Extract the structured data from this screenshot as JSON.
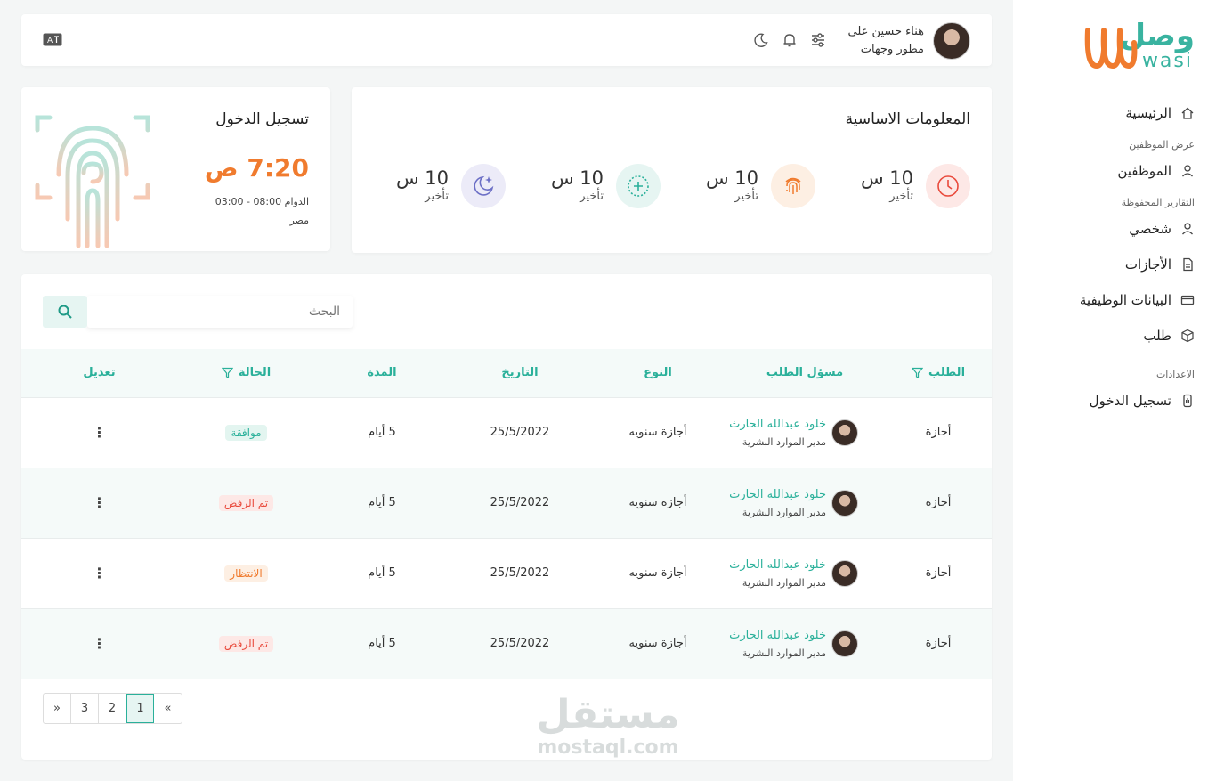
{
  "brand": {
    "name_ar": "وصل",
    "name_en": "wasi",
    "color": "#39b3a0",
    "accent": "#f07b2e"
  },
  "sidebar": {
    "home": "الرئيسية",
    "section_employees": "عرض الموظفين",
    "employees": "الموظفين",
    "section_reports": "التقارير المحفوظة",
    "personal": "شخصي",
    "leaves": "الأجازات",
    "job_data": "البيانات الوظيفية",
    "request": "طلب",
    "section_settings": "الاعدادات",
    "login": "تسجيل الدخول"
  },
  "header": {
    "user_name": "هناء حسين علي",
    "user_role": "مطور وجهات",
    "icons": [
      "sliders-icon",
      "bell-icon",
      "moon-icon",
      "language-icon"
    ]
  },
  "info": {
    "title": "المعلومات الاساسية",
    "stats": [
      {
        "value": "10 س",
        "label": "تأخير",
        "icon": "clock-icon",
        "color": "#e94a3c",
        "bg": "#fde8e6"
      },
      {
        "value": "10 س",
        "label": "تأخير",
        "icon": "fingerprint-icon",
        "color": "#f07b2e",
        "bg": "#fdefe3"
      },
      {
        "value": "10 س",
        "label": "تأخير",
        "icon": "plus-circle-icon",
        "color": "#2ab09a",
        "bg": "#e6f5f2"
      },
      {
        "value": "10 س",
        "label": "تأخير",
        "icon": "moon-stars-icon",
        "color": "#6c6fc6",
        "bg": "#ecebf8"
      }
    ]
  },
  "login": {
    "title": "تسجيل الدخول",
    "time": "7:20 ص",
    "shift": "الدوام 08:00 - 03:00",
    "country": "مصر"
  },
  "table": {
    "search_placeholder": "البحث",
    "headers": {
      "request": "الطلب",
      "responsible": "مسؤل الطلب",
      "type": "النوع",
      "date": "التاريخ",
      "duration": "المدة",
      "status": "الحالة",
      "edit": "تعديل"
    },
    "rows": [
      {
        "request": "أجازة",
        "name": "خلود عبدالله الحارث",
        "role": "مدير الموارد البشرية",
        "type": "أجازة سنويه",
        "date": "25/5/2022",
        "duration": "5 أيام",
        "status": "موافقة",
        "status_kind": "ok"
      },
      {
        "request": "أجازة",
        "name": "خلود عبدالله الحارث",
        "role": "مدير الموارد البشرية",
        "type": "أجازة سنويه",
        "date": "25/5/2022",
        "duration": "5 أيام",
        "status": "تم الرفض",
        "status_kind": "no"
      },
      {
        "request": "أجازة",
        "name": "خلود عبدالله الحارث",
        "role": "مدير الموارد البشرية",
        "type": "أجازة سنويه",
        "date": "25/5/2022",
        "duration": "5 أيام",
        "status": "الانتظار",
        "status_kind": "wait"
      },
      {
        "request": "أجازة",
        "name": "خلود عبدالله الحارث",
        "role": "مدير الموارد البشرية",
        "type": "أجازة سنويه",
        "date": "25/5/2022",
        "duration": "5 أيام",
        "status": "تم الرفض",
        "status_kind": "no"
      }
    ],
    "kebab": "⋮"
  },
  "pagination": {
    "prev": "«",
    "pages": [
      "1",
      "2",
      "3"
    ],
    "next": "»",
    "current": "1"
  },
  "watermark": {
    "ar": "مستقل",
    "en": "mostaql.com"
  }
}
